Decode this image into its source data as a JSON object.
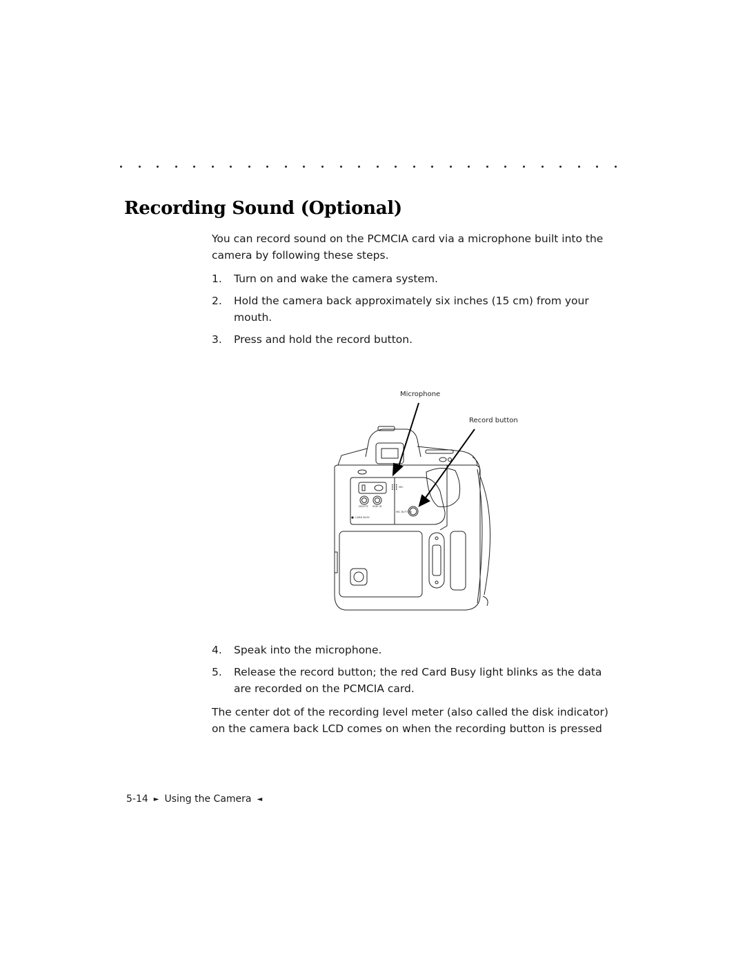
{
  "section": {
    "title": "Recording Sound (Optional)",
    "intro": "You can record sound on the PCMCIA card via a microphone built into the camera by following these steps."
  },
  "steps_before_figure": [
    {
      "number": "1.",
      "text": "Turn on and wake the camera system."
    },
    {
      "number": "2.",
      "text": "Hold the camera back approximately six inches (15 cm) from your mouth."
    },
    {
      "number": "3.",
      "text": "Press and hold the record button."
    }
  ],
  "figure": {
    "callouts": {
      "microphone": "Microphone",
      "record_button": "Record button"
    },
    "camera_labels": {
      "mic": "MIC",
      "delete": "DELETE",
      "side_id": "SIDE ID",
      "mic_button": "MIC BUTTON",
      "card_busy": "CARD BUSY"
    }
  },
  "steps_after_figure": [
    {
      "number": "4.",
      "text": "Speak into the microphone."
    },
    {
      "number": "5.",
      "text": "Release the record button; the red Card Busy light blinks as the data are recorded on the PCMCIA card."
    }
  ],
  "closing": "The center dot of the recording level meter (also called the disk indicator) on the camera back LCD comes on when the recording button is pressed",
  "footer": {
    "page_number": "5-14",
    "left_marker": "►",
    "chapter": "Using the Camera",
    "right_marker": "◄"
  }
}
